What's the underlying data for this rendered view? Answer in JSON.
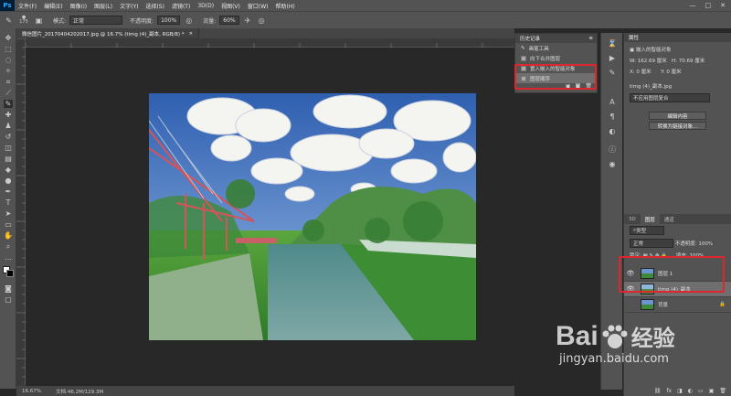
{
  "menubar": {
    "logo": "Ps",
    "items": [
      "文件(F)",
      "编辑(E)",
      "图像(I)",
      "图层(L)",
      "文字(Y)",
      "选择(S)",
      "滤镜(T)",
      "3D(D)",
      "视图(V)",
      "窗口(W)",
      "帮助(H)"
    ],
    "minimize": "—",
    "maximize": "□",
    "close": "✕"
  },
  "options": {
    "brush_size": "175",
    "mode_label": "模式:",
    "mode_value": "正常",
    "opacity_label": "不透明度:",
    "opacity_value": "100%",
    "flow_label": "流量:",
    "flow_value": "60%"
  },
  "document": {
    "tab_title": "微信图片_20170404202017.jpg @ 16.7% (timg (4)_副本, RGB/8) *",
    "tab_close": "×",
    "zoom": "16.67%",
    "doc_size": "文档:46.2M/129.3M"
  },
  "history": {
    "title": "历史记录",
    "items": [
      "画笔工具",
      "向下合并图层",
      "置入嵌入的智能对象",
      "图层顺序"
    ]
  },
  "properties": {
    "title": "属性",
    "subtitle": "嵌入的智能对象",
    "w_label": "W:",
    "w_value": "162.69 厘米",
    "h_label": "H:",
    "h_value": "70.69 厘米",
    "x_label": "X:",
    "x_value": "0 厘米",
    "y_label": "Y:",
    "y_value": "0 厘米",
    "filename": "timg (4)_副本.jpg",
    "comps": "不应用图层复合",
    "edit_btn": "编辑内容",
    "convert_btn": "转换为链接对象..."
  },
  "layers": {
    "tabs": [
      "3D",
      "图层",
      "通道"
    ],
    "kind_label": "类型",
    "blend_mode": "正常",
    "opacity_label": "不透明度:",
    "opacity_value": "100%",
    "lock_label": "锁定:",
    "fill_label": "填充:",
    "fill_value": "100%",
    "rows": [
      {
        "name": "图层 1"
      },
      {
        "name": "timg (4)_副本"
      },
      {
        "name": "背景"
      }
    ],
    "lock_icon": "🔒"
  },
  "watermark": {
    "brand_a": "Bai",
    "brand_b": "经验",
    "url": "jingyan.baidu.com"
  },
  "colors": {
    "highlight": "#e0262c",
    "ps_blue": "#31a8ff"
  }
}
